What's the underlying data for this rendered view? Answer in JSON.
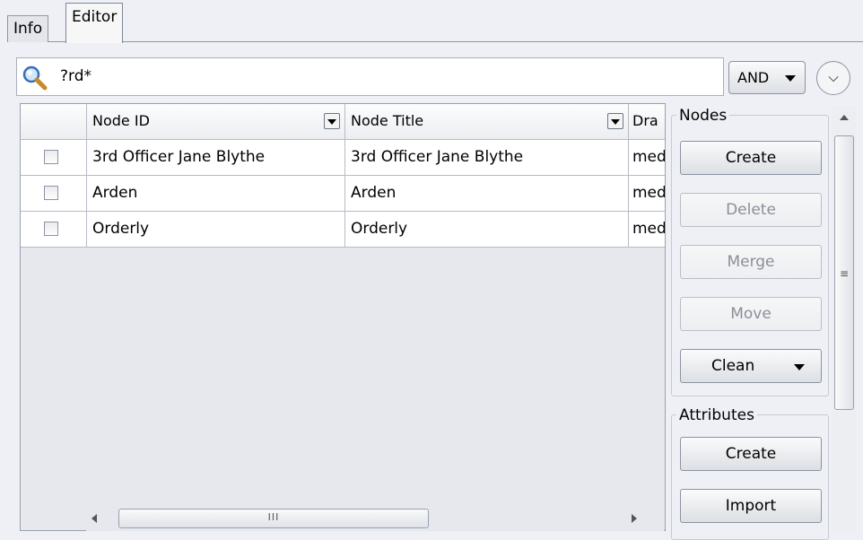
{
  "tabs": [
    {
      "label": "Info"
    },
    {
      "label": "Editor"
    }
  ],
  "search": {
    "value": "?rd*",
    "icon": "search-icon"
  },
  "filter": {
    "operator": "AND"
  },
  "table": {
    "columns": [
      "Node ID",
      "Node Title",
      "Dra"
    ],
    "rows": [
      {
        "id": "3rd Officer Jane Blythe",
        "title": "3rd Officer Jane Blythe",
        "third": "med"
      },
      {
        "id": "Arden",
        "title": "Arden",
        "third": "med"
      },
      {
        "id": "Orderly",
        "title": "Orderly",
        "third": "med"
      }
    ]
  },
  "nodes_panel": {
    "legend": "Nodes",
    "create": "Create",
    "delete": "Delete",
    "merge": "Merge",
    "move": "Move",
    "clean": "Clean"
  },
  "attributes_panel": {
    "legend": "Attributes",
    "create": "Create",
    "import": "Import"
  },
  "scrollbars": {
    "hthumb_grip": "III",
    "vthumb_grip": "≡"
  }
}
